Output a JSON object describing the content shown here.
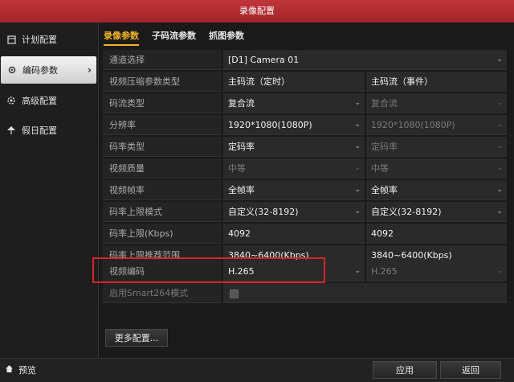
{
  "window": {
    "title": "录像配置"
  },
  "sidebar": {
    "items": [
      {
        "label": "计划配置",
        "icon": "schedule-icon"
      },
      {
        "label": "编码参数",
        "icon": "encoding-gear-icon",
        "active": true
      },
      {
        "label": "高级配置",
        "icon": "advanced-settings-icon"
      },
      {
        "label": "假日配置",
        "icon": "holiday-icon"
      }
    ],
    "preview_label": "预览"
  },
  "tabs": [
    {
      "label": "录像参数",
      "active": true
    },
    {
      "label": "子码流参数"
    },
    {
      "label": "抓图参数"
    }
  ],
  "form": {
    "channel": {
      "label": "通道选择",
      "value": "[D1] Camera 01"
    },
    "rows": [
      {
        "label": "视频压缩参数类型",
        "main": "主码流（定时）",
        "event": "主码流（事件）"
      },
      {
        "label": "码流类型",
        "main": "复合流",
        "event": "复合流"
      },
      {
        "label": "分辨率",
        "main": "1920*1080(1080P)",
        "event": "1920*1080(1080P)"
      },
      {
        "label": "码率类型",
        "main": "定码率",
        "event": "定码率"
      },
      {
        "label": "视频质量",
        "main": "中等",
        "event": "中等"
      },
      {
        "label": "视频帧率",
        "main": "全帧率",
        "event": "全帧率"
      },
      {
        "label": "码率上限模式",
        "main": "自定义(32-8192)",
        "event": "自定义(32-8192)"
      },
      {
        "label": "码率上限(Kbps)",
        "main": "4092",
        "event": "4092"
      },
      {
        "label": "码率上限推荐范围",
        "main": "3840~6400(Kbps)",
        "event": "3840~6400(Kbps)"
      },
      {
        "label": "视频编码",
        "main": "H.265",
        "event": "H.265"
      }
    ],
    "smart": {
      "label": "启用Smart264模式"
    }
  },
  "buttons": {
    "more": "更多配置...",
    "apply": "应用",
    "back": "返回"
  },
  "colors": {
    "title_bar": "#b02a2e",
    "active_tab": "#f3b623",
    "highlight_box": "#d8232a"
  }
}
